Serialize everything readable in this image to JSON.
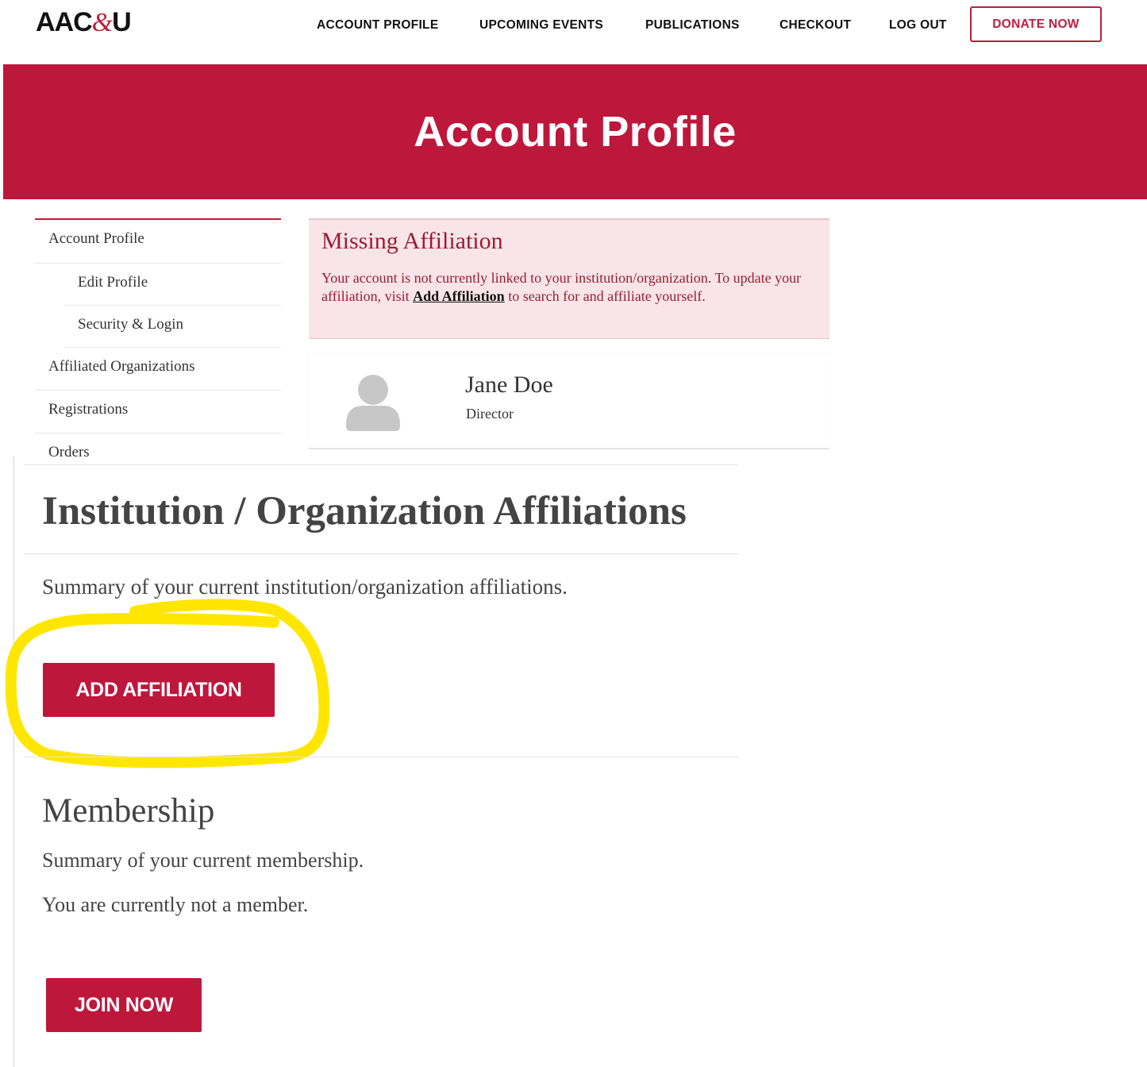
{
  "header": {
    "logo_main": "AAC",
    "logo_amp": "&",
    "logo_end": "U",
    "nav": [
      {
        "label": "ACCOUNT PROFILE"
      },
      {
        "label": "UPCOMING EVENTS"
      },
      {
        "label": "PUBLICATIONS"
      },
      {
        "label": "CHECKOUT"
      },
      {
        "label": "LOG OUT"
      }
    ],
    "donate_label": "DONATE NOW"
  },
  "hero": {
    "title": "Account Profile"
  },
  "sidebar": {
    "items": [
      {
        "label": "Account Profile"
      },
      {
        "label": "Edit Profile"
      },
      {
        "label": "Security & Login"
      },
      {
        "label": "Affiliated Organizations"
      },
      {
        "label": "Registrations"
      },
      {
        "label": "Orders"
      }
    ]
  },
  "alert": {
    "title": "Missing Affiliation",
    "text_before": "Your account is not currently linked to your institution/organization. To update your affiliation, visit ",
    "link": "Add Affiliation",
    "text_after": " to search for and affiliate yourself."
  },
  "profile": {
    "name": "Jane Doe",
    "role": "Director",
    "avatar_icon": "user-silhouette-icon"
  },
  "affiliations": {
    "title": "Institution / Organization Affiliations",
    "subtitle": "Summary of your current institution/organization affiliations.",
    "button": "ADD AFFILIATION"
  },
  "membership": {
    "title": "Membership",
    "subtitle": "Summary of your current membership.",
    "status": "You are currently not a member.",
    "button": "JOIN NOW"
  },
  "colors": {
    "brand": "#be173c",
    "highlight": "#ffe600",
    "alert_bg": "#f9e5e8"
  }
}
